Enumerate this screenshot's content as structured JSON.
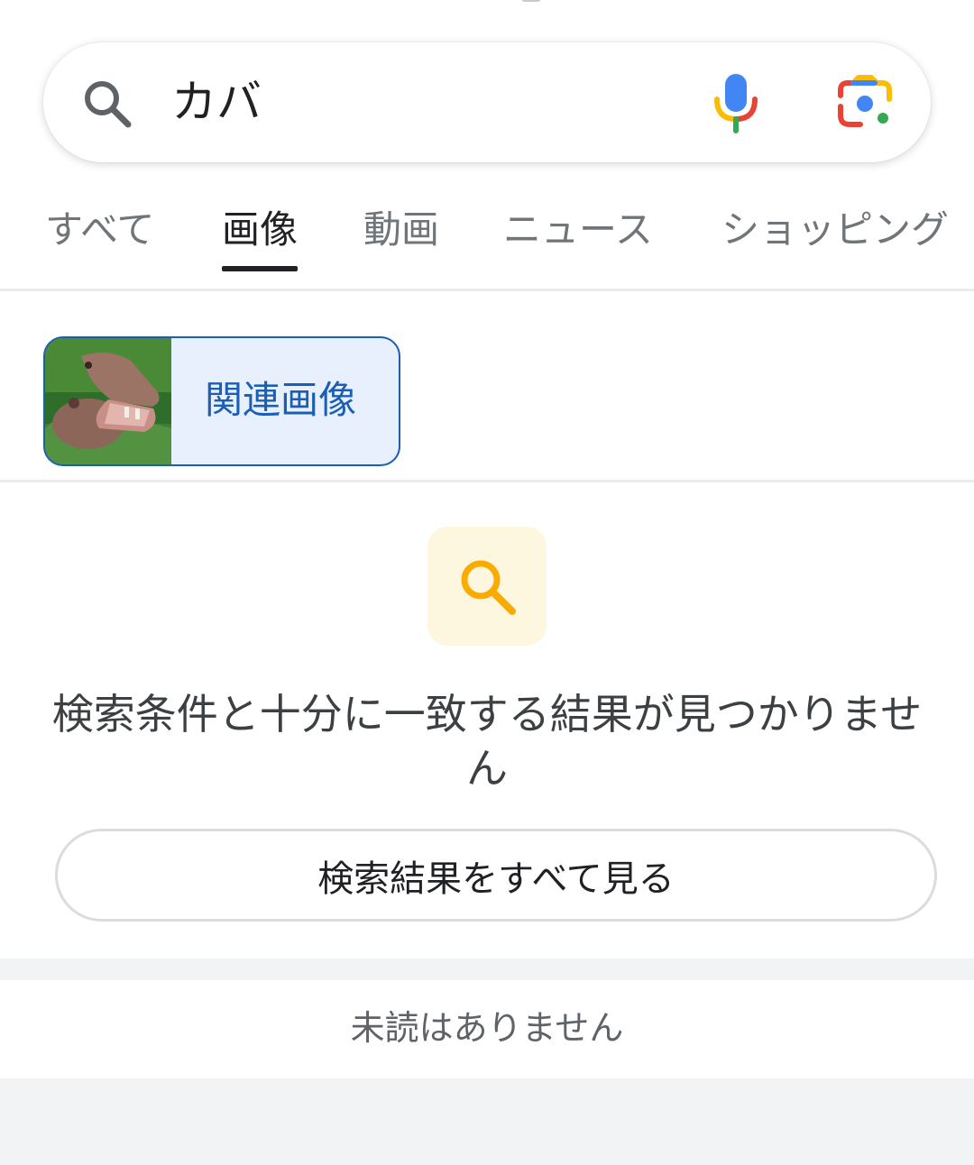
{
  "search": {
    "query": "カバ",
    "icons": {
      "search": "search-icon",
      "voice": "mic-icon",
      "lens": "google-lens-icon"
    }
  },
  "tabs": [
    {
      "label": "すべて",
      "active": false
    },
    {
      "label": "画像",
      "active": true
    },
    {
      "label": "動画",
      "active": false
    },
    {
      "label": "ニュース",
      "active": false
    },
    {
      "label": "ショッピング",
      "active": false
    }
  ],
  "related": {
    "label": "関連画像",
    "thumbnail": "hippo-thumbnail"
  },
  "no_results": {
    "message": "検索条件と十分に一致する結果が見つかりません",
    "button_label": "検索結果をすべて見る",
    "icon": "search-icon"
  },
  "footer": {
    "unread_text": "未読はありません"
  },
  "colors": {
    "accent_blue": "#1a5fb4",
    "chip_bg": "#e8f0fd",
    "icon_yellow": "#f9ab00",
    "icon_bg": "#fef7e0",
    "text_primary": "#202124",
    "text_secondary": "#70757a"
  }
}
